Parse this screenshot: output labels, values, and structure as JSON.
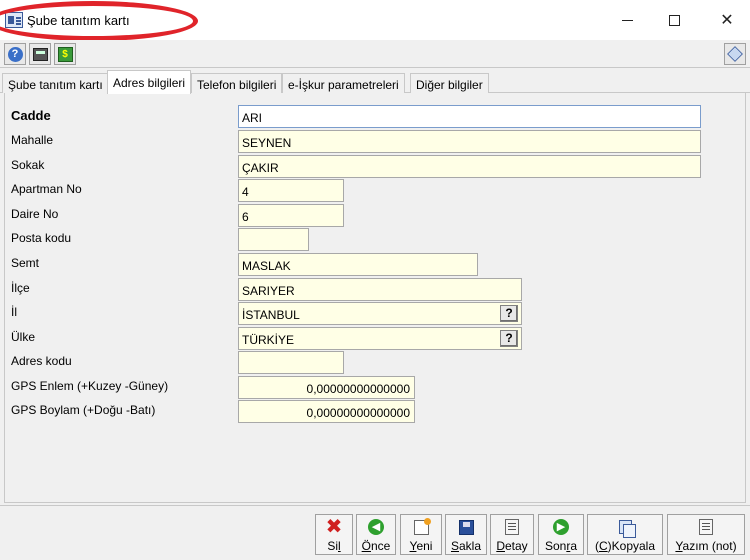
{
  "window": {
    "title": "Şube tanıtım kartı",
    "minimize_glyph": "—",
    "maximize_glyph": "☐",
    "close_glyph": "✕"
  },
  "toolbar": {
    "icons": [
      "help-icon",
      "calculator-icon",
      "currency-icon",
      "cube-icon"
    ],
    "help_glyph": "?",
    "currency_glyph": "$"
  },
  "tabs": [
    {
      "label": "Şube tanıtım kartı",
      "active": false
    },
    {
      "label": "Adres bilgileri",
      "active": true
    },
    {
      "label": "Telefon bilgileri",
      "active": false
    },
    {
      "label": "e-İşkur parametreleri",
      "active": false
    },
    {
      "label": "Diğer bilgiler",
      "active": false
    }
  ],
  "form": {
    "cadde": {
      "label": "Cadde",
      "value": "ARI"
    },
    "mahalle": {
      "label": "Mahalle",
      "value": "SEYNEN"
    },
    "sokak": {
      "label": "Sokak",
      "value": "ÇAKIR"
    },
    "apartman_no": {
      "label": "Apartman No",
      "value": "4"
    },
    "daire_no": {
      "label": "Daire No",
      "value": "6"
    },
    "posta_kodu": {
      "label": "Posta kodu",
      "value": ""
    },
    "semt": {
      "label": "Semt",
      "value": "MASLAK"
    },
    "ilce": {
      "label": "İlçe",
      "value": "SARIYER"
    },
    "il": {
      "label": "İl",
      "value": "İSTANBUL"
    },
    "ulke": {
      "label": "Ülke",
      "value": "TÜRKİYE"
    },
    "adres_kodu": {
      "label": "Adres kodu",
      "value": ""
    },
    "gps_enlem": {
      "label": "GPS Enlem (+Kuzey -Güney)",
      "value": "0,00000000000000"
    },
    "gps_boylam": {
      "label": "GPS Boylam (+Doğu -Batı)",
      "value": "0,00000000000000"
    },
    "lookup_glyph": "?"
  },
  "actions": {
    "sil": {
      "pre": "Si",
      "key": "l",
      "post": "",
      "glyph": "✖",
      "color": "#d02020"
    },
    "once": {
      "pre": "",
      "key": "Ö",
      "post": "nce",
      "glyph": "◀",
      "color": "#2ea02e"
    },
    "yeni": {
      "pre": "",
      "key": "Y",
      "post": "eni"
    },
    "sakla": {
      "pre": "",
      "key": "S",
      "post": "akla"
    },
    "detay": {
      "pre": "",
      "key": "D",
      "post": "etay"
    },
    "sonra": {
      "pre": "Son",
      "key": "r",
      "post": "a",
      "glyph": "▶",
      "color": "#2ea02e"
    },
    "kopyala": {
      "pre": "(",
      "key": "C",
      "post": ")Kopyala"
    },
    "yazim": {
      "pre": "",
      "key": "Y",
      "post": "azım (not)"
    }
  }
}
